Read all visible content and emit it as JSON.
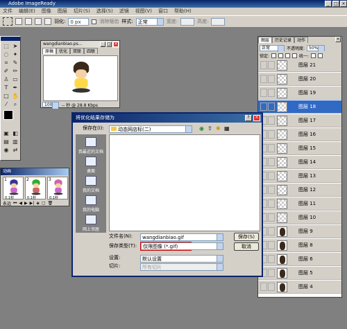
{
  "app": {
    "title": "Adobe ImageReady"
  },
  "menu": [
    "文件",
    "编辑(E)",
    "图像",
    "图层",
    "切片(S)",
    "选择(S)",
    "滤镜",
    "视图(V)",
    "窗口",
    "帮助(H)"
  ],
  "options": {
    "slice_label": "羽化:",
    "slice_value": "0 px",
    "antialias_label": "消除锯齿",
    "style_label": "样式:",
    "style_value": "正常",
    "width_label": "宽度:",
    "height_label": "高度:"
  },
  "image_window": {
    "title": "wangdianbiao.ps...",
    "tabs": [
      "原稿",
      "优化",
      "双联",
      "四联"
    ],
    "zoom": "100%",
    "status": "-- 秒 @ 28.8 Kbps"
  },
  "animation": {
    "title": "动画",
    "frames": [
      {
        "num": "1",
        "delay": "0.1秒",
        "hair": "#333399",
        "body": "#cc66cc"
      },
      {
        "num": "2",
        "delay": "0.1秒",
        "hair": "#33aa33",
        "body": "#cc6666"
      },
      {
        "num": "3",
        "delay": "0.1秒",
        "hair": "#cc66aa",
        "body": "#cc66cc"
      }
    ],
    "loop": "永远"
  },
  "layers_panel": {
    "tabs": [
      "图层",
      "历史记录",
      "动作"
    ],
    "blend": "正常",
    "opacity_label": "不透明度:",
    "opacity_value": "50%",
    "lock_label": "锁定:",
    "unify_label": "统一:",
    "rows": [
      {
        "name": "图层 21",
        "selected": false
      },
      {
        "name": "图层 20",
        "selected": false
      },
      {
        "name": "图层 19",
        "selected": false
      },
      {
        "name": "图层 18",
        "selected": true
      },
      {
        "name": "图层 17",
        "selected": false
      },
      {
        "name": "图层 16",
        "selected": false
      },
      {
        "name": "图层 15",
        "selected": false
      },
      {
        "name": "图层 14",
        "selected": false
      },
      {
        "name": "图层 13",
        "selected": false
      },
      {
        "name": "图层 12",
        "selected": false
      },
      {
        "name": "图层 11",
        "selected": false
      },
      {
        "name": "图层 10",
        "selected": false
      },
      {
        "name": "图层 9",
        "selected": false
      },
      {
        "name": "图层 8",
        "selected": false
      },
      {
        "name": "图层 6",
        "selected": false
      },
      {
        "name": "图层 5",
        "selected": false
      },
      {
        "name": "图层 4",
        "selected": false
      }
    ]
  },
  "dialog": {
    "title": "将优化结果存储为",
    "save_in_label": "保存在(I):",
    "save_in_value": "动态网店标(二)",
    "places": [
      "我最近的文档",
      "桌面",
      "我的文档",
      "我的电脑",
      "网上邻居"
    ],
    "filename_label": "文件名(N):",
    "filename_value": "wangdianbiao.gif",
    "savetype_label": "保存类型(T):",
    "savetype_value": "仅限图像 (*.gif)",
    "settings_label": "设置:",
    "settings_value": "默认设置",
    "slices_label": "切片:",
    "slices_value": "所有切片",
    "save_btn": "保存(S)",
    "cancel_btn": "取消"
  }
}
